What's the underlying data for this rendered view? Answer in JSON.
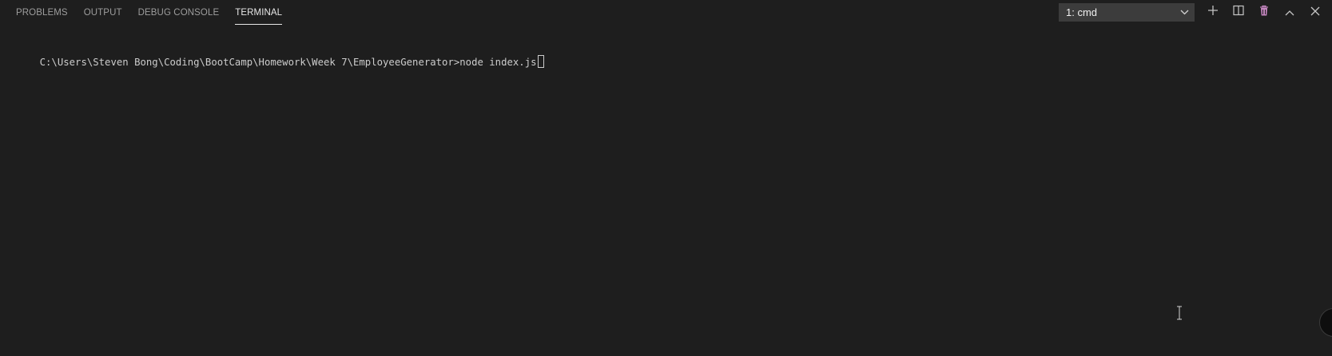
{
  "tabs": [
    {
      "label": "PROBLEMS",
      "active": false
    },
    {
      "label": "OUTPUT",
      "active": false
    },
    {
      "label": "DEBUG CONSOLE",
      "active": false
    },
    {
      "label": "TERMINAL",
      "active": true
    }
  ],
  "terminal_select": {
    "value": "1: cmd"
  },
  "actions": [
    {
      "name": "new-terminal",
      "icon": "plus-icon"
    },
    {
      "name": "split-terminal",
      "icon": "split-icon"
    },
    {
      "name": "kill-terminal",
      "icon": "trash-icon"
    },
    {
      "name": "maximize-panel",
      "icon": "chevron-up-icon"
    },
    {
      "name": "close-panel",
      "icon": "close-icon"
    }
  ],
  "terminal": {
    "prompt": "C:\\Users\\Steven Bong\\Coding\\BootCamp\\Homework\\Week 7\\EmployeeGenerator>",
    "command": "node index.js"
  },
  "colors": {
    "background": "#1e1e1e",
    "tab_inactive": "#9d9d9d",
    "tab_active": "#e7e7e7",
    "select_bg": "#3c3c3c",
    "terminal_text": "#cccccc",
    "trash_icon": "#c586c0"
  }
}
